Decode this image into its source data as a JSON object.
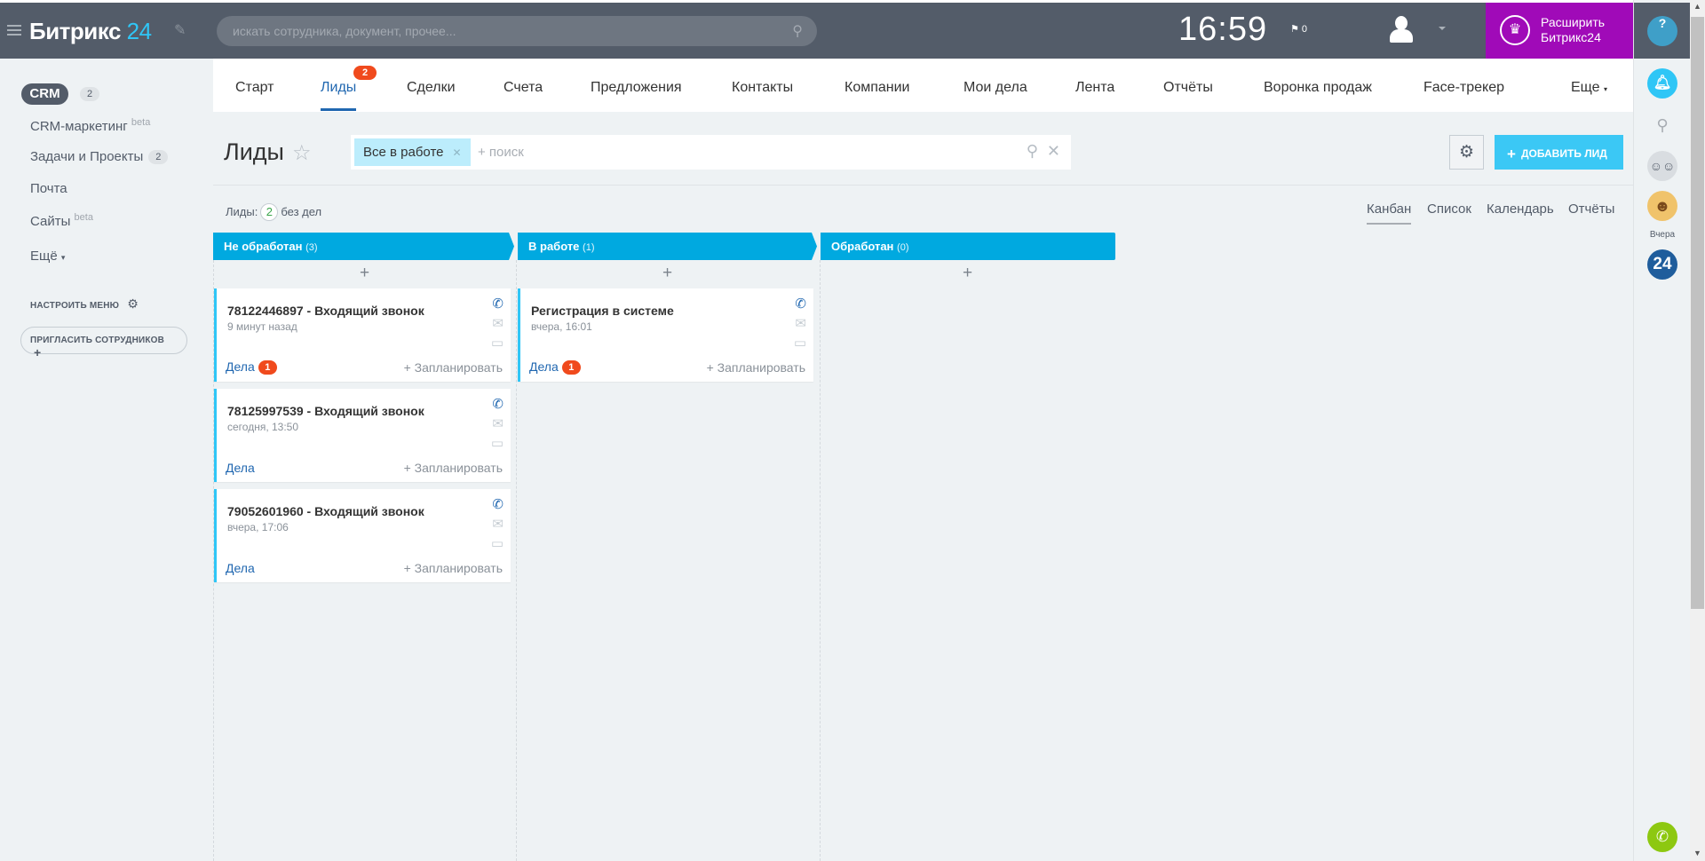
{
  "header": {
    "logo_text": "Битрикс",
    "logo_num": "24",
    "search_placeholder": "искать сотрудника, документ, прочее...",
    "clock": "16:59",
    "flag_count": "0",
    "upgrade_line1": "Расширить",
    "upgrade_line2": "Битрикс24"
  },
  "sidebar": {
    "crm": "CRM",
    "crm_count": "2",
    "items": [
      {
        "label": "CRM-маркетинг",
        "sup": "beta"
      },
      {
        "label": "Задачи и Проекты",
        "count": "2"
      },
      {
        "label": "Почта"
      },
      {
        "label": "Сайты",
        "sup": "beta"
      },
      {
        "label": "Ещё"
      }
    ],
    "configure": "НАСТРОИТЬ МЕНЮ",
    "invite": "ПРИГЛАСИТЬ СОТРУДНИКОВ"
  },
  "nav": {
    "tabs": [
      "Старт",
      "Лиды",
      "Сделки",
      "Счета",
      "Предложения",
      "Контакты",
      "Компании",
      "Мои дела",
      "Лента",
      "Отчёты",
      "Воронка продаж",
      "Face-трекер",
      "Еще"
    ],
    "leads_badge": "2"
  },
  "page": {
    "title": "Лиды",
    "filter_chip": "Все в работе",
    "filter_search": "+ поиск",
    "add_button": "ДОБАВИТЬ ЛИД",
    "stat_label": "Лиды:",
    "stat_count": "2",
    "stat_suffix": "без дел",
    "views": [
      "Канбан",
      "Список",
      "Календарь",
      "Отчёты"
    ]
  },
  "columns": [
    {
      "title": "Не обработан",
      "count": "(3)",
      "cards": [
        {
          "title": "78122446897 - Входящий звонок",
          "date": "9 минут назад",
          "deals": "Дела",
          "deals_badge": "1",
          "plan": "+ Запланировать"
        },
        {
          "title": "78125997539 - Входящий звонок",
          "date": "сегодня, 13:50",
          "deals": "Дела",
          "plan": "+ Запланировать"
        },
        {
          "title": "79052601960 - Входящий звонок",
          "date": "вчера, 17:06",
          "deals": "Дела",
          "plan": "+ Запланировать"
        }
      ]
    },
    {
      "title": "В работе",
      "count": "(1)",
      "cards": [
        {
          "title": "Регистрация в системе",
          "date": "вчера, 16:01",
          "deals": "Дела",
          "deals_badge": "1",
          "plan": "+ Запланировать"
        }
      ]
    },
    {
      "title": "Обработан",
      "count": "(0)",
      "cards": []
    }
  ],
  "right_panel": {
    "yesterday": "Вчера",
    "logo24": "24",
    "help": "?"
  },
  "colors": {
    "header": "#535c69",
    "accent": "#00a9e0",
    "upgrade": "#a00ab8",
    "badge": "#f04a1d",
    "phone": "#8dc811"
  }
}
